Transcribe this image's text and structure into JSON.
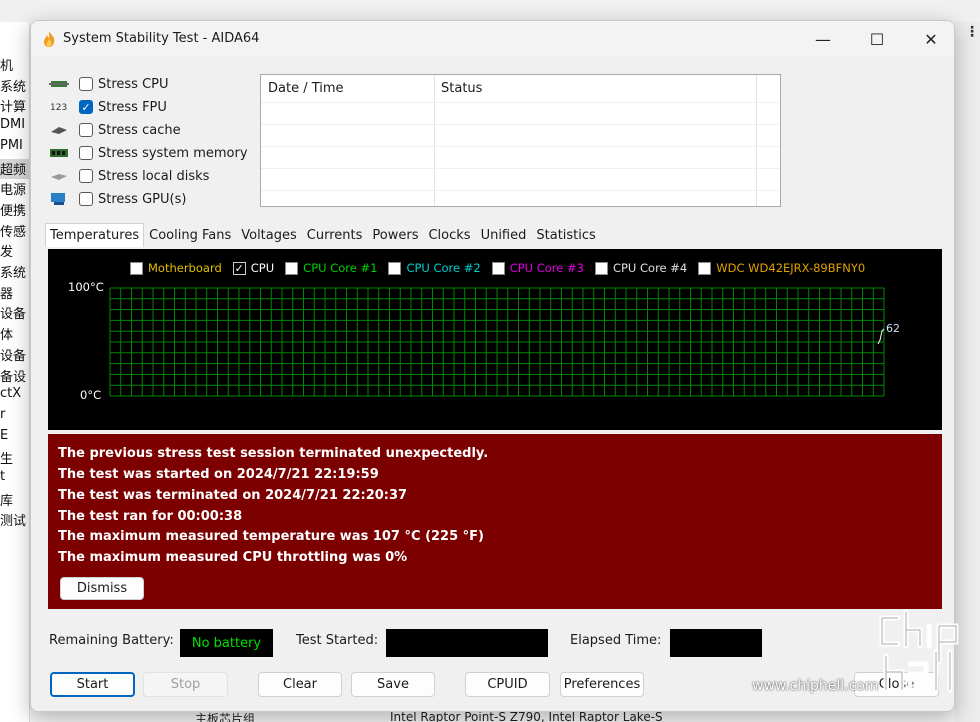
{
  "window": {
    "title": "System Stability Test - AIDA64",
    "minimize_glyph": "—",
    "maximize_glyph": "☐",
    "close_glyph": "✕"
  },
  "stress_options": [
    {
      "label": "Stress CPU",
      "checked": false,
      "icon": "cpu-chip-icon"
    },
    {
      "label": "Stress FPU",
      "checked": true,
      "icon": "fpu-123-icon"
    },
    {
      "label": "Stress cache",
      "checked": false,
      "icon": "cache-chip-icon"
    },
    {
      "label": "Stress system memory",
      "checked": false,
      "icon": "memory-module-icon"
    },
    {
      "label": "Stress local disks",
      "checked": false,
      "icon": "disk-drive-icon"
    },
    {
      "label": "Stress GPU(s)",
      "checked": false,
      "icon": "gpu-display-icon"
    }
  ],
  "log_table": {
    "columns": [
      "Date / Time",
      "Status"
    ],
    "rows": []
  },
  "tabs": [
    "Temperatures",
    "Cooling Fans",
    "Voltages",
    "Currents",
    "Powers",
    "Clocks",
    "Unified",
    "Statistics"
  ],
  "active_tab": "Temperatures",
  "graph": {
    "legend": [
      {
        "label": "Motherboard",
        "checked": false,
        "color": "#e0c000"
      },
      {
        "label": "CPU",
        "checked": true,
        "color": "#ffffff"
      },
      {
        "label": "CPU Core #1",
        "checked": false,
        "color": "#00d000"
      },
      {
        "label": "CPU Core #2",
        "checked": false,
        "color": "#00d0d0"
      },
      {
        "label": "CPU Core #3",
        "checked": false,
        "color": "#e000e0"
      },
      {
        "label": "CPU Core #4",
        "checked": false,
        "color": "#e0e0e0"
      },
      {
        "label": "WDC WD42EJRX-89BFNY0",
        "checked": false,
        "color": "#e0a000"
      }
    ],
    "y_max_label": "100°C",
    "y_min_label": "0°C",
    "current_value_label": "62",
    "grid_color": "#008800",
    "background": "#000000"
  },
  "chart_data": {
    "type": "line",
    "title": "",
    "xlabel": "",
    "ylabel": "",
    "ylim": [
      0,
      100
    ],
    "series": [
      {
        "name": "CPU",
        "values": [
          62
        ]
      }
    ]
  },
  "warning": {
    "lines": [
      "The previous stress test session terminated unexpectedly.",
      "The test was started on 2024/7/21 22:19:59",
      "The test was terminated on 2024/7/21 22:20:37",
      "The test ran for 00:00:38",
      "The maximum measured temperature was 107 °C  (225 °F)",
      "The maximum measured CPU throttling was 0%"
    ],
    "dismiss_label": "Dismiss",
    "background": "#7c0000"
  },
  "status": {
    "battery_label": "Remaining Battery:",
    "battery_value": "No battery",
    "battery_value_color": "#00e000",
    "test_started_label": "Test Started:",
    "test_started_value": "",
    "elapsed_label": "Elapsed Time:",
    "elapsed_value": ""
  },
  "buttons": {
    "start": "Start",
    "stop": "Stop",
    "clear": "Clear",
    "save": "Save",
    "cpuid": "CPUID",
    "preferences": "Preferences",
    "close": "Close"
  },
  "background_app": {
    "left_items": [
      "机",
      "系统",
      "计算",
      "DMI",
      "PMI",
      "超频",
      "电源",
      "便携",
      "传感",
      "发",
      "系统",
      "器",
      "设备",
      "体",
      "设备",
      "备设",
      "ctX",
      "r",
      "E",
      "生",
      "t",
      "库",
      "测试"
    ],
    "bottom_row": {
      "col1": "主板芯片组",
      "col2": "Intel Raptor Point-S Z790, Intel Raptor Lake-S"
    }
  },
  "watermark": {
    "text": "www.chiphell.com"
  }
}
